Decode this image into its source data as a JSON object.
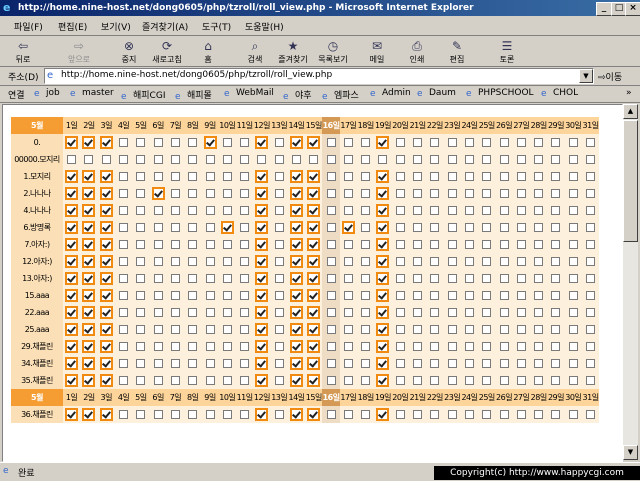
{
  "window": {
    "title": "http://home.nine-host.net/dong0605/php/tzroll/roll_view.php - Microsoft Internet Explorer"
  },
  "menu": [
    "파일(F)",
    "편집(E)",
    "보기(V)",
    "즐겨찾기(A)",
    "도구(T)",
    "도움말(H)"
  ],
  "toolbar": {
    "back": "뒤로",
    "forward": "앞으로",
    "stop": "중지",
    "refresh": "새로고침",
    "home": "홈",
    "search": "검색",
    "favorites": "즐겨찾기",
    "history": "목록보기",
    "mail": "메일",
    "print": "인쇄",
    "edit": "편집",
    "discuss": "토론"
  },
  "address": {
    "label": "주소(D)",
    "url": "http://home.nine-host.net/dong0605/php/tzroll/roll_view.php",
    "go": "이동"
  },
  "links": {
    "label": "연결",
    "items": [
      "job",
      "master",
      "해피CGI",
      "해피몰",
      "WebMail",
      "야후",
      "엠파스",
      "Admin",
      "Daum",
      "PHPSCHOOL",
      "CHOL"
    ]
  },
  "roll": {
    "month_label": "5월",
    "days": [
      "1일",
      "2일",
      "3일",
      "4일",
      "5일",
      "6일",
      "7일",
      "8일",
      "9일",
      "10일",
      "11일",
      "12일",
      "13일",
      "14일",
      "15일",
      "16일",
      "17일",
      "18일",
      "19일",
      "20일",
      "21일",
      "22일",
      "23일",
      "24일",
      "25일",
      "26일",
      "27일",
      "28일",
      "29일",
      "30일",
      "31일"
    ],
    "today_index": 15,
    "people": [
      {
        "name": "0.",
        "checked": [
          1,
          2,
          3,
          9,
          12,
          14,
          15,
          19
        ]
      },
      {
        "name": "00000.모지리",
        "checked": []
      },
      {
        "name": "1.모지리",
        "checked": [
          1,
          2,
          3,
          12,
          14,
          15,
          19
        ]
      },
      {
        "name": "2.나나나",
        "checked": [
          1,
          2,
          3,
          6,
          12,
          14,
          15,
          19
        ]
      },
      {
        "name": "4.나나나",
        "checked": [
          1,
          2,
          3,
          12,
          14,
          15,
          19
        ]
      },
      {
        "name": "6.방명록",
        "checked": [
          1,
          2,
          3,
          10,
          12,
          14,
          15,
          17,
          19
        ]
      },
      {
        "name": "7.아자:)",
        "checked": [
          1,
          2,
          3,
          12,
          14,
          15,
          19
        ]
      },
      {
        "name": "12.아자:)",
        "checked": [
          1,
          2,
          3,
          12,
          14,
          15,
          19
        ]
      },
      {
        "name": "13.아자:)",
        "checked": [
          1,
          2,
          3,
          12,
          14,
          15,
          19
        ]
      },
      {
        "name": "15.aaa",
        "checked": [
          1,
          2,
          3,
          12,
          14,
          15,
          19
        ]
      },
      {
        "name": "22.aaa",
        "checked": [
          1,
          2,
          3,
          12,
          14,
          15,
          19
        ]
      },
      {
        "name": "25.aaa",
        "checked": [
          1,
          2,
          3,
          12,
          14,
          15,
          19
        ]
      },
      {
        "name": "29.채플린",
        "checked": [
          1,
          2,
          3,
          12,
          14,
          15,
          19
        ]
      },
      {
        "name": "34.채플린",
        "checked": [
          1,
          2,
          3,
          12,
          14,
          15,
          19
        ]
      },
      {
        "name": "35.채플린",
        "checked": [
          1,
          2,
          3,
          12,
          14,
          15,
          19
        ]
      },
      {
        "header": true
      },
      {
        "name": "36.채플린",
        "checked": [
          1,
          2,
          3,
          12,
          14,
          15,
          19
        ]
      }
    ]
  },
  "status": {
    "text": "완료"
  },
  "copyright": "Copyright(c) http://www.happycgi.com",
  "colors": {
    "month_header": "#f59d32",
    "day_header": "#fdd49a",
    "checked_border": "#f08a10",
    "today_column": "#d49a55"
  }
}
